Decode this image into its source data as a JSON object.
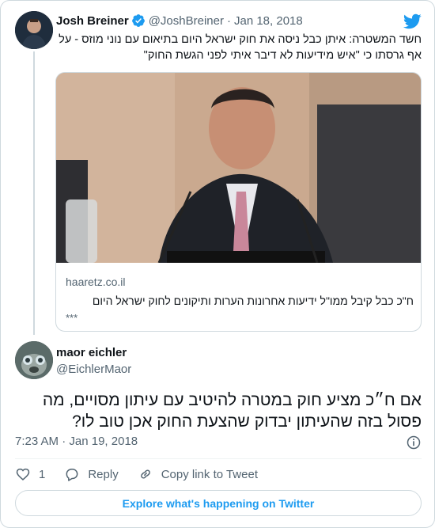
{
  "colors": {
    "brand_blue": "#1d9bf0",
    "text_primary": "#0f1419",
    "text_secondary": "#536471",
    "border": "#cfd9de"
  },
  "parent_tweet": {
    "author_name": "Josh Breiner",
    "verified_icon": "verified-badge-icon",
    "handle": "@JoshBreiner",
    "separator": "·",
    "date": "Jan 18, 2018",
    "text": "חשד המשטרה: איתן כבל ניסה את חוק ישראל היום בתיאום עם נוני מוזס - על אף גרסתו כי \"איש מידיעות לא דיבר איתי לפני הגשת החוק\"",
    "link_card": {
      "domain": "haaretz.co.il",
      "title": "ח\"כ כבל קיבל ממו\"ל ידיעות אחרונות הערות ותיקונים לחוק ישראל היום",
      "description": "***"
    }
  },
  "main_tweet": {
    "author_name": "maor eichler",
    "handle": "@EichlerMaor",
    "text": "אם ח״כ מציע חוק במטרה להיטיב עם עיתון מסויים, מה פסול בזה שהעיתון יבדוק שהצעת החוק אכן טוב לו?",
    "time": "7:23 AM",
    "separator": "·",
    "date": "Jan 19, 2018"
  },
  "actions": {
    "like_count": "1",
    "reply_label": "Reply",
    "copy_link_label": "Copy link to Tweet"
  },
  "explore_button": "Explore what's happening on Twitter"
}
